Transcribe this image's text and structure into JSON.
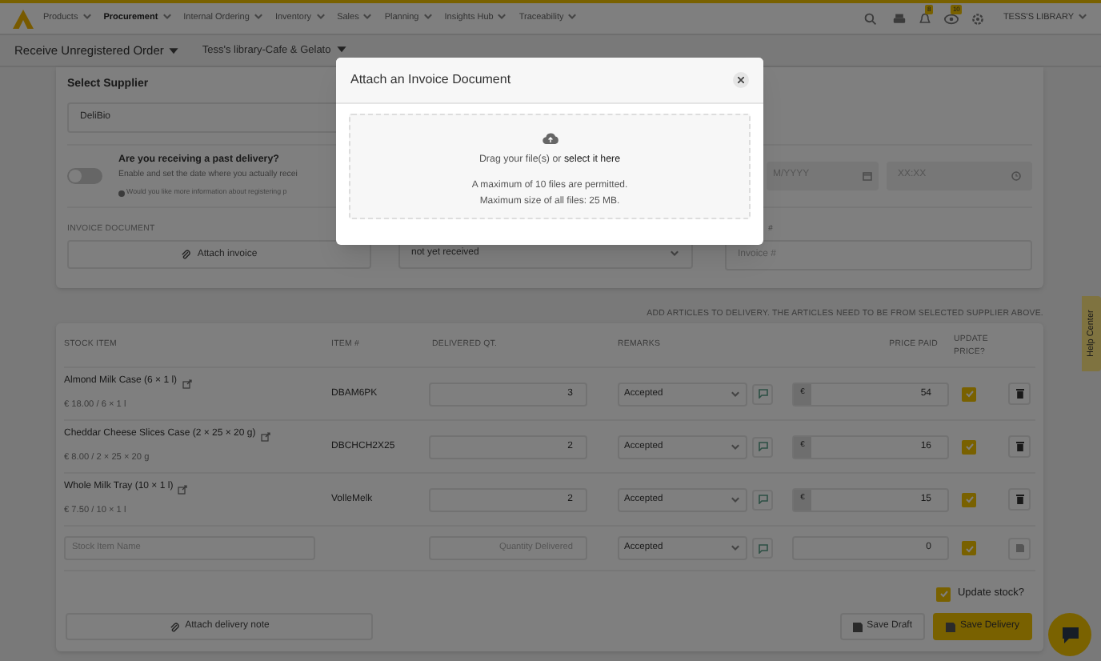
{
  "nav": {
    "menus": [
      {
        "label": "Products",
        "selected": false
      },
      {
        "label": "Procurement",
        "selected": true
      },
      {
        "label": "Internal Ordering",
        "selected": false
      },
      {
        "label": "Inventory",
        "selected": false
      },
      {
        "label": "Sales",
        "selected": false
      },
      {
        "label": "Planning",
        "selected": false
      },
      {
        "label": "Insights Hub",
        "selected": false
      },
      {
        "label": "Traceability",
        "selected": false
      }
    ],
    "badges": [
      "8",
      "10"
    ],
    "user": "TESS'S LIBRARY"
  },
  "subbar": {
    "title": "Receive Unregistered Order",
    "location": "Tess's library-Cafe & Gelato"
  },
  "form": {
    "supplier_label": "Select Supplier",
    "supplier": "DeliBio",
    "past_delivery": {
      "on": false,
      "title": "Are you receiving a past delivery?",
      "text": "Enable and set the date where you actually recei",
      "info": "Would you like more information about registering p",
      "date_placeholder": "M/YYYY",
      "time_placeholder": "XX:XX"
    },
    "invoice_label": "INVOICE DOCUMENT",
    "attach_invoice": "Attach invoice",
    "invoice_status": "not yet received",
    "invoice_no_label": "#",
    "invoice_no_placeholder": "Invoice #"
  },
  "notice": "ADD ARTICLES TO DELIVERY. THE ARTICLES NEED TO BE FROM SELECTED SUPPLIER ABOVE.",
  "table": {
    "columns": [
      "STOCK ITEM",
      "ITEM #",
      "DELIVERED QT.",
      "REMARKS",
      "PRICE PAID",
      "UPDATE PRICE?"
    ],
    "rows": [
      {
        "name": "Almond Milk Case (6 × 1 l)",
        "unit_price": "€ 18.00 / 6 × 1 l",
        "item_no": "DBAM6PK",
        "qty": "3",
        "remark": "Accepted",
        "currency": "€",
        "price": "54",
        "update_price": true
      },
      {
        "name": "Cheddar Cheese Slices Case (2 × 25 × 20 g)",
        "unit_price": "€ 8.00 / 2 × 25 × 20 g",
        "item_no": "DBCHCH2X25",
        "qty": "2",
        "remark": "Accepted",
        "currency": "€",
        "price": "16",
        "update_price": true
      },
      {
        "name": "Whole Milk Tray (10 × 1 l)",
        "unit_price": "€ 7.50 / 10 × 1 l",
        "item_no": "VolleMelk",
        "qty": "2",
        "remark": "Accepted",
        "currency": "€",
        "price": "15",
        "update_price": true
      }
    ],
    "new_row": {
      "name_placeholder": "Stock Item Name",
      "qty_placeholder": "Quantity Delivered",
      "remark": "Accepted",
      "price": "0",
      "update_price": true
    }
  },
  "update_stock": {
    "label": "Update stock?",
    "checked": true
  },
  "buttons": {
    "attach_note": "Attach delivery note",
    "save_draft": "Save Draft",
    "save_delivery": "Save Delivery"
  },
  "help_tab": "Help Center",
  "modal": {
    "title": "Attach an Invoice Document",
    "drop_text": "Drag your file(s) or",
    "drop_link": "select it here",
    "limit_1": "A maximum of 10 files are permitted.",
    "limit_2": "Maximum size of all files: 25 MB."
  }
}
